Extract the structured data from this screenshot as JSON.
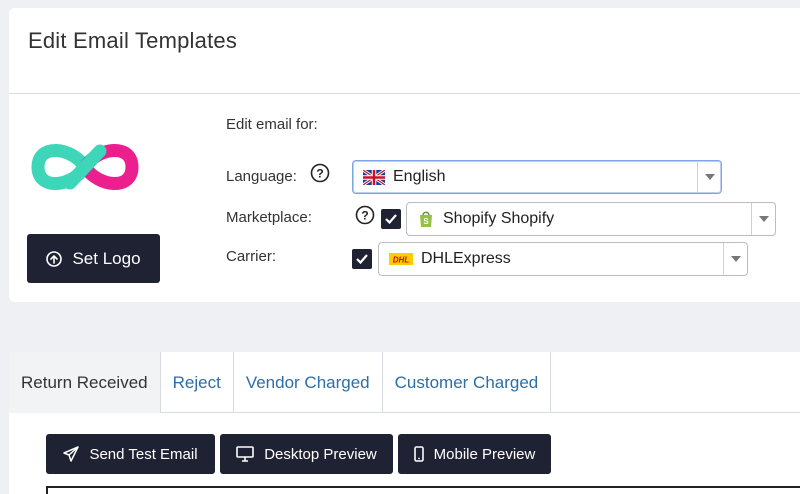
{
  "header": {
    "title": "Edit Email Templates"
  },
  "logo": {
    "button_label": "Set Logo",
    "colors": {
      "teal": "#3ed6b9",
      "magenta": "#ec1f8f"
    }
  },
  "form": {
    "heading": "Edit email for:",
    "language": {
      "label": "Language:",
      "value": "English",
      "flag": "uk-flag-icon"
    },
    "marketplace": {
      "label": "Marketplace:",
      "value": "Shopify Shopify",
      "checked": true,
      "icon": "shopify-bag-icon"
    },
    "carrier": {
      "label": "Carrier:",
      "value": "DHLExpress",
      "checked": true,
      "icon": "dhl-logo-icon"
    }
  },
  "tabs": [
    {
      "label": "Return Received",
      "active": true
    },
    {
      "label": "Reject",
      "active": false
    },
    {
      "label": "Vendor Charged",
      "active": false
    },
    {
      "label": "Customer Charged",
      "active": false
    }
  ],
  "actions": {
    "send_test": "Send Test Email",
    "desktop_preview": "Desktop Preview",
    "mobile_preview": "Mobile Preview"
  },
  "colors": {
    "primary_button": "#1f2233",
    "link": "#2d6ea5"
  }
}
